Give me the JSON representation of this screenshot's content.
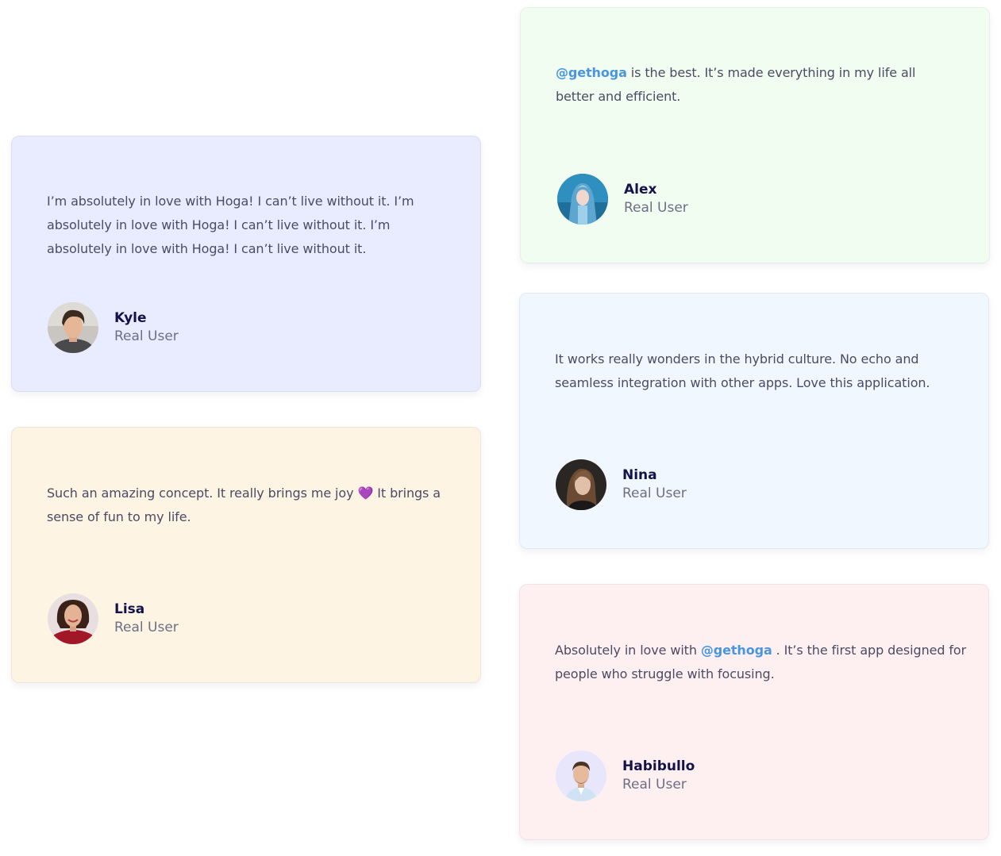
{
  "testimonials": {
    "kyle": {
      "quote": "I’m absolutely in love with Hoga! I can’t live without it. I’m absolutely in love with Hoga! I can’t live without it. I’m absolutely in love with Hoga! I can’t live without it.",
      "name": "Kyle",
      "role": "Real User",
      "bg": "#e9ecfe"
    },
    "lisa": {
      "quote_part1": "Such an amazing concept. It really brings me joy",
      "emoji": "💜",
      "quote_part2": "It brings a sense of fun to my life.",
      "name": "Lisa",
      "role": "Real User",
      "bg": "#fdf4e4"
    },
    "alex": {
      "mention": "@gethoga",
      "quote": " is the best. It’s made everything in my life all better and efficient.",
      "name": "Alex",
      "role": "Real User",
      "bg": "#f2fdf2"
    },
    "nina": {
      "quote": "It works really wonders in the hybrid culture. No echo and seamless integration with other apps. Love this application.",
      "name": "Nina",
      "role": "Real User",
      "bg": "#f0f7fe"
    },
    "habibullo": {
      "quote_part1": "Absolutely in love with ",
      "mention": "@gethoga",
      "quote_part2": " . It’s the first app designed for people who struggle with focusing.",
      "name": "Habibullo",
      "role": "Real User",
      "bg": "#fef0f1"
    }
  },
  "colors": {
    "mention": "#4a95e0",
    "name": "#14124a",
    "role": "#6e6e85",
    "text": "#4b4b63"
  }
}
